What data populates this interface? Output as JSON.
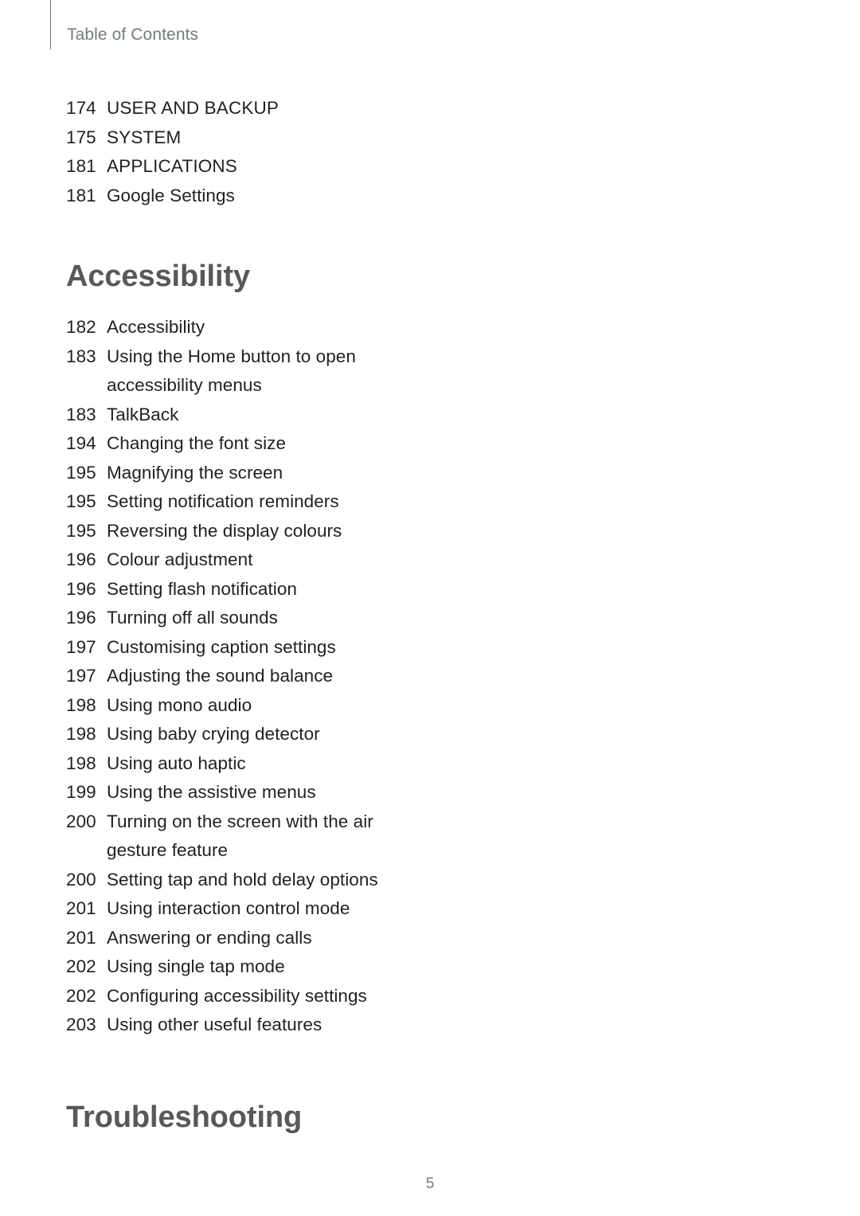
{
  "header": {
    "title": "Table of Contents"
  },
  "blocks": [
    {
      "type": "list",
      "entries": [
        {
          "page": "174",
          "title": "USER AND BACKUP",
          "uppercase": true
        },
        {
          "page": "175",
          "title": "SYSTEM",
          "uppercase": true
        },
        {
          "page": "181",
          "title": "APPLICATIONS",
          "uppercase": true
        },
        {
          "page": "181",
          "title": "Google Settings",
          "uppercase": false
        }
      ]
    },
    {
      "type": "heading",
      "text": "Accessibility"
    },
    {
      "type": "list",
      "entries": [
        {
          "page": "182",
          "title": "Accessibility",
          "uppercase": false
        },
        {
          "page": "183",
          "title": "Using the Home button to open\naccessibility menus",
          "uppercase": false
        },
        {
          "page": "183",
          "title": "TalkBack",
          "uppercase": false
        },
        {
          "page": "194",
          "title": "Changing the font size",
          "uppercase": false
        },
        {
          "page": "195",
          "title": "Magnifying the screen",
          "uppercase": false
        },
        {
          "page": "195",
          "title": "Setting notification reminders",
          "uppercase": false
        },
        {
          "page": "195",
          "title": "Reversing the display colours",
          "uppercase": false
        },
        {
          "page": "196",
          "title": "Colour adjustment",
          "uppercase": false
        },
        {
          "page": "196",
          "title": "Setting flash notification",
          "uppercase": false
        },
        {
          "page": "196",
          "title": "Turning off all sounds",
          "uppercase": false
        },
        {
          "page": "197",
          "title": "Customising caption settings",
          "uppercase": false
        },
        {
          "page": "197",
          "title": "Adjusting the sound balance",
          "uppercase": false
        },
        {
          "page": "198",
          "title": "Using mono audio",
          "uppercase": false
        },
        {
          "page": "198",
          "title": "Using baby crying detector",
          "uppercase": false
        },
        {
          "page": "198",
          "title": "Using auto haptic",
          "uppercase": false
        },
        {
          "page": "199",
          "title": "Using the assistive menus",
          "uppercase": false
        },
        {
          "page": "200",
          "title": "Turning on the screen with the air\ngesture feature",
          "uppercase": false
        },
        {
          "page": "200",
          "title": "Setting tap and hold delay options",
          "uppercase": false
        },
        {
          "page": "201",
          "title": "Using interaction control mode",
          "uppercase": false
        },
        {
          "page": "201",
          "title": "Answering or ending calls",
          "uppercase": false
        },
        {
          "page": "202",
          "title": "Using single tap mode",
          "uppercase": false
        },
        {
          "page": "202",
          "title": "Configuring accessibility settings",
          "uppercase": false
        },
        {
          "page": "203",
          "title": "Using other useful features",
          "uppercase": false
        }
      ]
    },
    {
      "type": "heading",
      "text": "Troubleshooting"
    }
  ],
  "folio": {
    "page_number": "5"
  },
  "colors": {
    "header_text": "#6d7d7d",
    "header_rule": "#6d7b7c",
    "heading_text": "#58585a",
    "body_text": "#231f20",
    "folio_text": "#6d7d7d",
    "background": "#ffffff"
  }
}
